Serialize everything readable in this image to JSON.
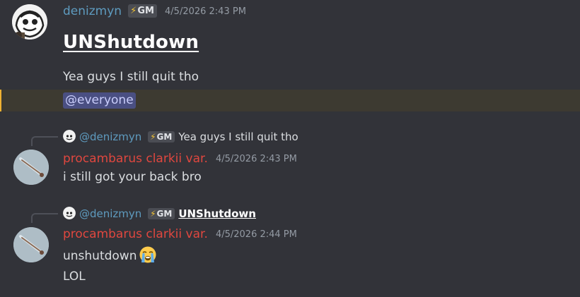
{
  "messages": [
    {
      "author": "denizmyn",
      "badge": "GM",
      "timestamp": "4/5/2026 2:43 PM",
      "heading": "UNShutdown",
      "body": "Yea guys I still quit tho",
      "mention": "@everyone"
    },
    {
      "reply": {
        "author": "@denizmyn",
        "badge": "GM",
        "preview": "Yea guys I still quit tho"
      },
      "author": "procambarus clarkii var.",
      "timestamp": "4/5/2026 2:43 PM",
      "body": "i still got your back bro"
    },
    {
      "reply": {
        "author": "@denizmyn",
        "badge": "GM",
        "preview": "UNShutdown"
      },
      "author": "procambarus clarkii var.",
      "timestamp": "4/5/2026 2:44 PM",
      "body": "unshutdown",
      "emoji": "loudly-crying-face",
      "body2": "LOL"
    }
  ],
  "colors": {
    "background": "#323339",
    "author_blue": "#5e9bbf",
    "author_red": "#e0473f",
    "mention_highlight": "#3d3a31",
    "mention_bar": "#f0b232",
    "mention_pill": "#4a4f82"
  }
}
